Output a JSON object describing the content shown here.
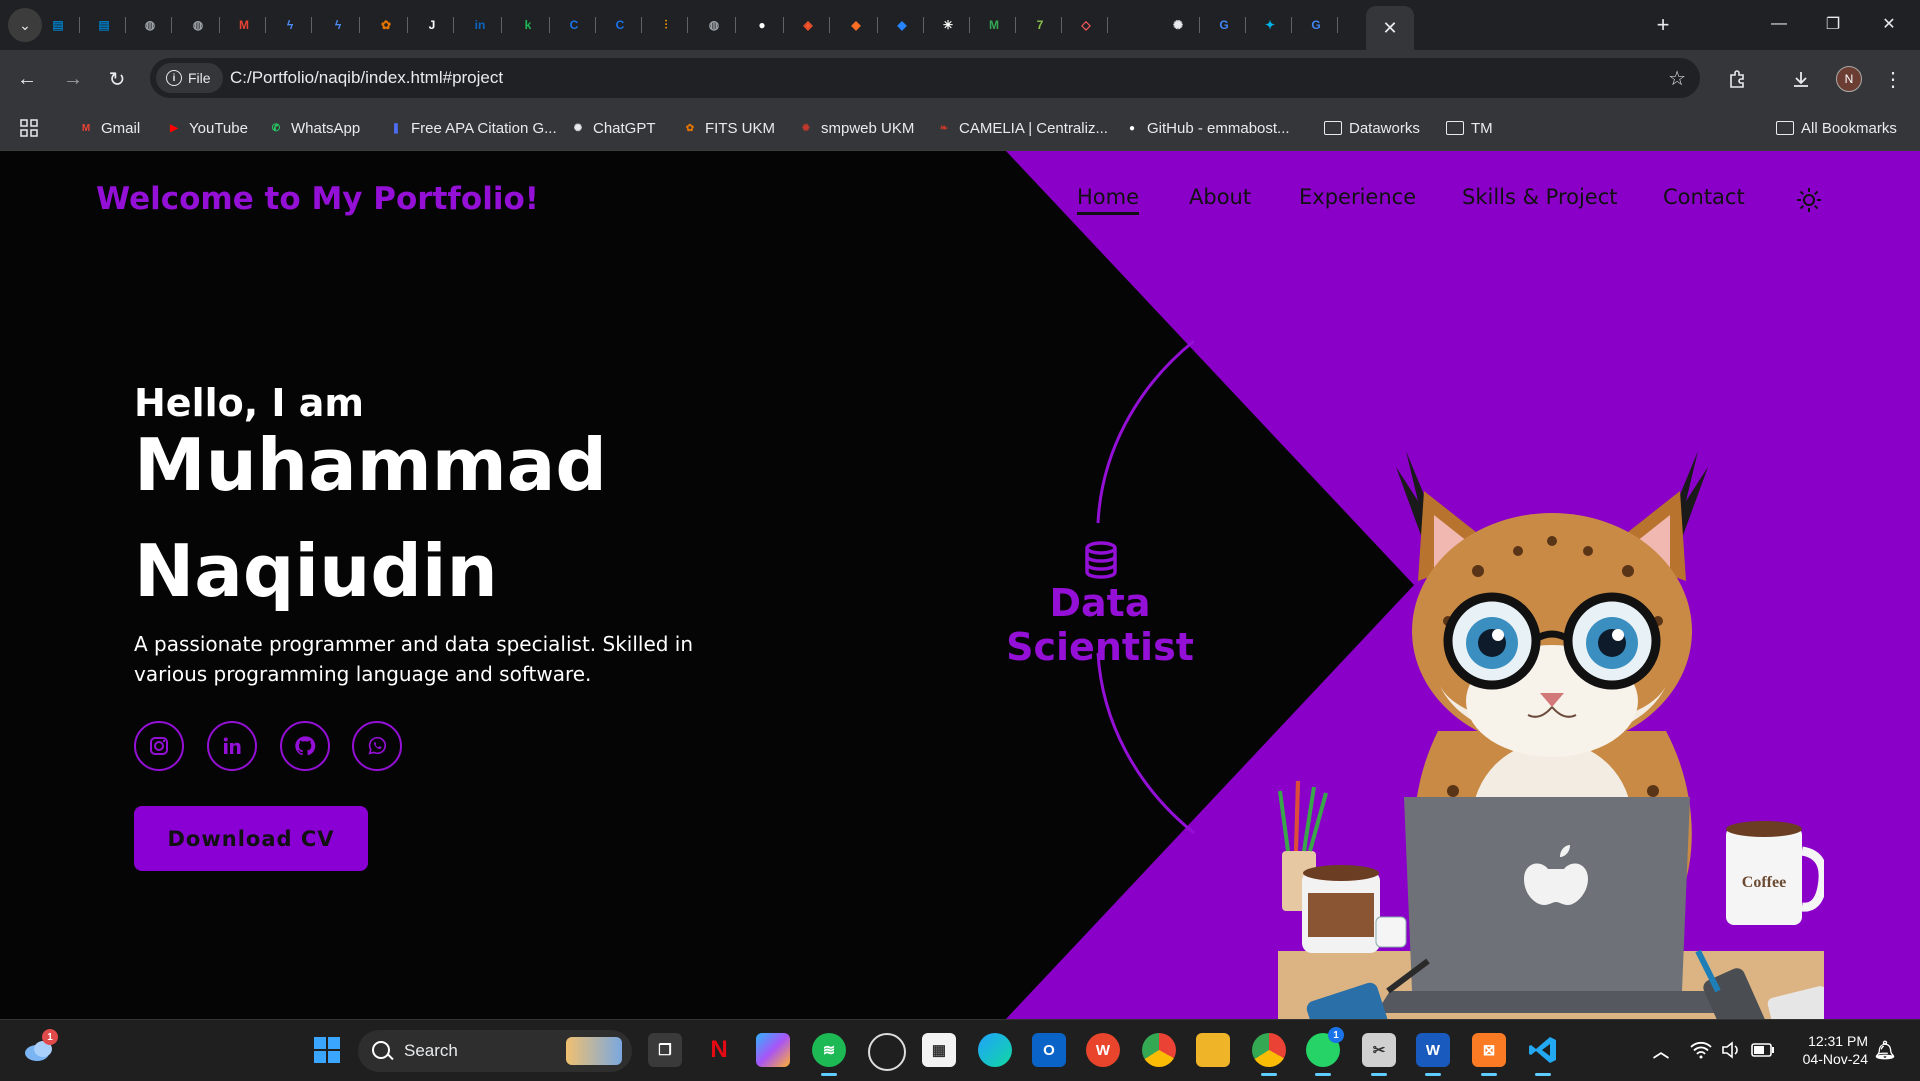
{
  "browser": {
    "tabs": [
      {
        "icon": "trello-icon",
        "color": "#0079bf"
      },
      {
        "icon": "trello-icon",
        "color": "#0079bf"
      },
      {
        "icon": "globe-icon",
        "color": "#9aa0a6"
      },
      {
        "icon": "globe-icon",
        "color": "#9aa0a6"
      },
      {
        "icon": "gmail-icon",
        "color": "#ea4335"
      },
      {
        "icon": "bolt-app-icon",
        "color": "#4c8bf5"
      },
      {
        "icon": "bolt-app-icon",
        "color": "#4c8bf5"
      },
      {
        "icon": "fits-icon",
        "color": "#e37400"
      },
      {
        "icon": "j-icon",
        "color": "#ffffff"
      },
      {
        "icon": "linkedin-icon",
        "color": "#0a66c2"
      },
      {
        "icon": "k-app-icon",
        "color": "#1db954"
      },
      {
        "icon": "c-app-icon",
        "color": "#1a73e8"
      },
      {
        "icon": "c-app-icon",
        "color": "#1a73e8"
      },
      {
        "icon": "chart-icon",
        "color": "#f29900"
      },
      {
        "icon": "globe-icon",
        "color": "#9aa0a6"
      },
      {
        "icon": "github-icon",
        "color": "#ffffff"
      },
      {
        "icon": "brave-icon",
        "color": "#fb542b"
      },
      {
        "icon": "gitlab-icon",
        "color": "#fc6d26"
      },
      {
        "icon": "jira-icon",
        "color": "#2684ff"
      },
      {
        "icon": "colorful-app-icon",
        "color": "#ffffff"
      },
      {
        "icon": "m-app-icon",
        "color": "#34a853"
      },
      {
        "icon": "seven-icon",
        "color": "#8bc34a"
      },
      {
        "icon": "airbnb-icon",
        "color": "#ff5a5f"
      },
      {
        "icon": "chatgpt-icon",
        "color": "#e8eaed"
      },
      {
        "icon": "google-icon",
        "color": "#4285f4"
      },
      {
        "icon": "sparkle-icon",
        "color": "#00b3e6"
      },
      {
        "icon": "google-icon",
        "color": "#4285f4"
      }
    ],
    "active_tab_close": "✕",
    "new_tab": "+",
    "omnibox": {
      "chip_label": "File",
      "url": "C:/Portfolio/naqib/index.html#project"
    },
    "profile_initial": "N",
    "bookmarks": [
      {
        "label": "Gmail",
        "icon": "gmail-icon",
        "color": "#ea4335"
      },
      {
        "label": "YouTube",
        "icon": "youtube-icon",
        "color": "#ff0000"
      },
      {
        "label": "WhatsApp",
        "icon": "whatsapp-icon",
        "color": "#25d366"
      },
      {
        "label": "Free APA Citation G...",
        "icon": "bookmark-icon",
        "color": "#4c6ef5"
      },
      {
        "label": "ChatGPT",
        "icon": "chatgpt-icon",
        "color": "#e8eaed"
      },
      {
        "label": "FITS UKM",
        "icon": "fits-icon",
        "color": "#e37400"
      },
      {
        "label": "smpweb UKM",
        "icon": "ukm-icon",
        "color": "#c0392b"
      },
      {
        "label": "CAMELIA | Centraliz...",
        "icon": "camelia-icon",
        "color": "#c0392b"
      },
      {
        "label": "GitHub - emmabost...",
        "icon": "github-icon",
        "color": "#ffffff"
      },
      {
        "label": "Dataworks",
        "icon": "folder-icon",
        "color": "#e8eaed"
      },
      {
        "label": "TM",
        "icon": "folder-icon",
        "color": "#e8eaed"
      }
    ],
    "all_bookmarks": "All Bookmarks"
  },
  "page": {
    "brand": "Welcome to My Portfolio!",
    "nav": [
      "Home",
      "About",
      "Experience",
      "Skills & Project",
      "Contact"
    ],
    "active_nav": "Home",
    "greeting": "Hello, I am",
    "name_line1": "Muhammad",
    "name_line2": "Naqiudin",
    "description": "A passionate programmer and data specialist. Skilled in various programming language and software.",
    "socials": [
      "instagram-icon",
      "linkedin-icon",
      "github-icon",
      "whatsapp-icon"
    ],
    "cta": "Download CV",
    "role": "Data Scientist",
    "illustration": {
      "coffee_mug_text": "Coffee"
    },
    "colors": {
      "accent": "#9410d6",
      "purple_bg": "#8a00c8",
      "dark_bg": "#050505"
    }
  },
  "taskbar": {
    "search_label": "Search",
    "weather_badge": "1",
    "whatsapp_badge": "1",
    "time": "12:31 PM",
    "date": "04-Nov-24"
  }
}
